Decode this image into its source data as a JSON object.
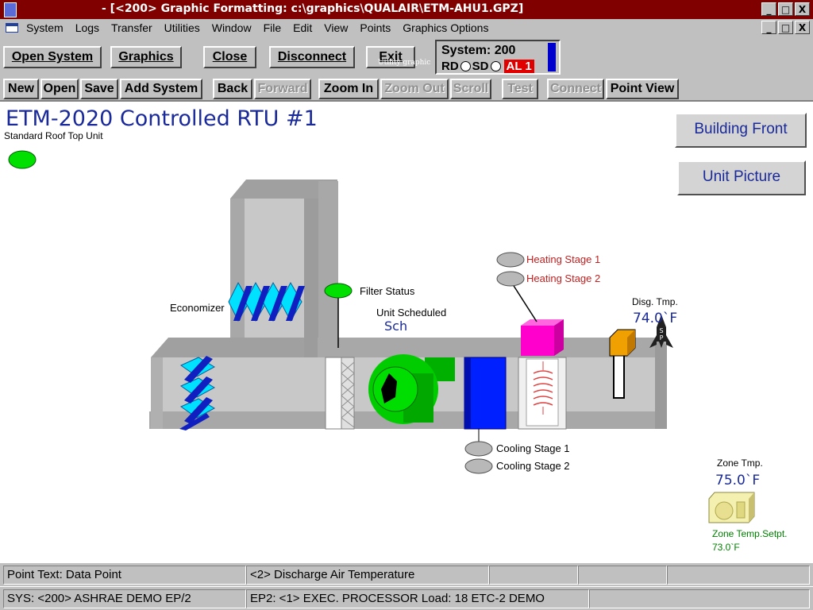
{
  "window": {
    "title": "- [<200> Graphic Formatting: c:\\graphics\\QUALAIR\\ETM-AHU1.GPZ]",
    "controls": {
      "minimize": "_",
      "restore": "×",
      "close": "X"
    }
  },
  "menu": {
    "items": [
      "System",
      "Logs",
      "Transfer",
      "Utilities",
      "Window",
      "File",
      "Edit",
      "View",
      "Points",
      "Graphics Options"
    ]
  },
  "toolbar1": {
    "open_system": "Open System",
    "graphics": "Graphics",
    "close": "Close",
    "disconnect": "Disconnect",
    "exit": "Exit",
    "exit_overlay": "Utility graphic"
  },
  "system_status": {
    "system": "System: 200",
    "rd": "RD",
    "sd": "SD",
    "alarm": "AL 1",
    "colors": {
      "alarm_bg": "#e00000",
      "indicator": "#0000cc"
    }
  },
  "toolbar2": {
    "new": "New",
    "open": "Open",
    "save": "Save",
    "add_system": "Add System",
    "back": "Back",
    "forward": "Forward",
    "zoom_in": "Zoom In",
    "zoom_out": "Zoom Out",
    "scroll": "Scroll",
    "test": "Test",
    "connect": "Connect",
    "point_view": "Point View"
  },
  "graphic": {
    "title": "ETM-2020 Controlled RTU #1",
    "subtitle": "Standard Roof Top Unit",
    "nav_buttons": {
      "building_front": "Building Front",
      "unit_picture": "Unit Picture"
    },
    "labels": {
      "economizer": "Economizer",
      "filter_status": "Filter Status",
      "unit_scheduled": "Unit Scheduled",
      "unit_scheduled_value": "Sch",
      "heating_stage_1": "Heating Stage 1",
      "heating_stage_2": "Heating Stage 2",
      "cooling_stage_1": "Cooling Stage 1",
      "cooling_stage_2": "Cooling Stage 2",
      "disg_tmp": "Disg. Tmp.",
      "disg_tmp_value": "74.0`F",
      "zone_tmp": "Zone Tmp.",
      "zone_tmp_value": "75.0`F",
      "zone_setpt": "Zone Temp.Setpt.",
      "zone_setpt_value": "73.0`F"
    },
    "colors": {
      "unit_on": "#00e000",
      "heating_text": "#c02020",
      "setpoint_text": "#008000",
      "value_text": "#1a2a9a",
      "heater": "#ff00cc",
      "coil": "#0000ff",
      "fan": "#00cc00",
      "damper": "#00ffff"
    },
    "icons": [
      "rocket-icon",
      "thermostat-icon"
    ]
  },
  "status": {
    "point_text": "Point Text: Data Point",
    "point_desc": "<2> Discharge Air Temperature",
    "sys": "SYS: <200> ASHRAE DEMO EP/2",
    "ep2": "EP2: <1> EXEC. PROCESSOR   Load: 18 ETC-2 DEMO"
  }
}
